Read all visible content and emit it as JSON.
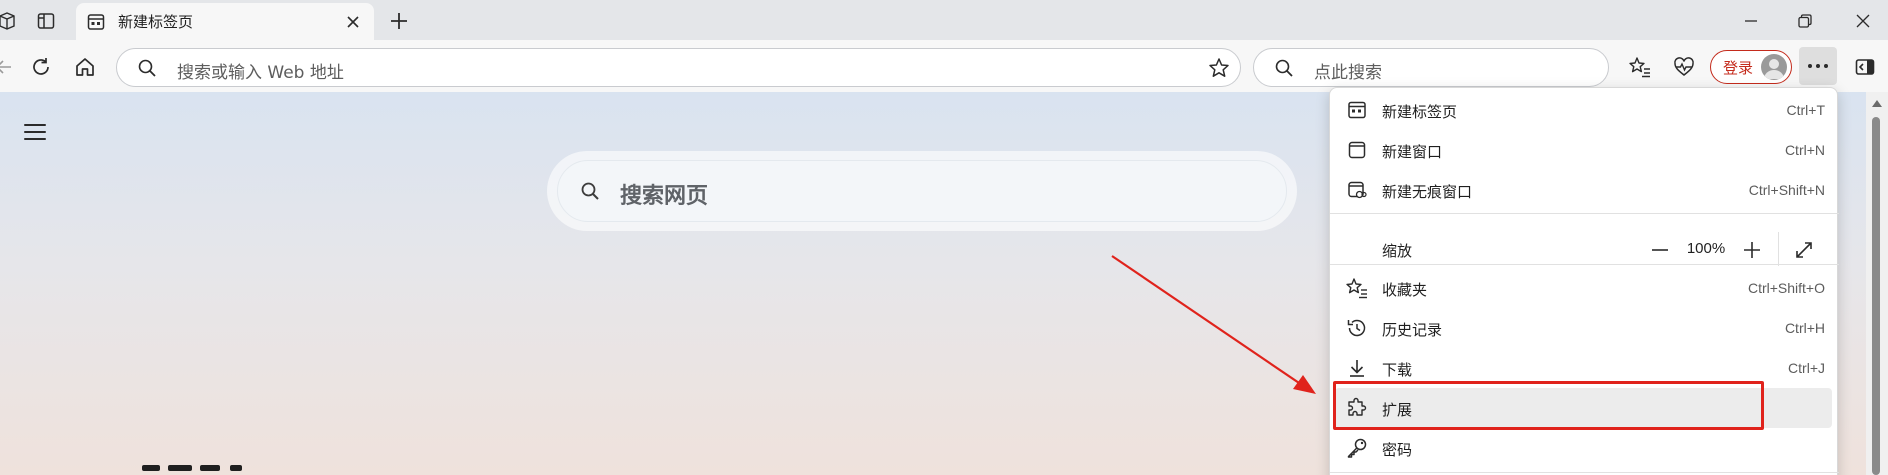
{
  "tab": {
    "title": "新建标签页"
  },
  "toolbar": {
    "address_placeholder": "搜索或输入 Web 地址",
    "search_placeholder": "点此搜索",
    "login_label": "登录"
  },
  "page": {
    "search_placeholder": "搜索网页"
  },
  "menu": {
    "items": [
      {
        "label": "新建标签页",
        "shortcut": "Ctrl+T",
        "icon": "new-tab-icon"
      },
      {
        "label": "新建窗口",
        "shortcut": "Ctrl+N",
        "icon": "new-window-icon"
      },
      {
        "label": "新建无痕窗口",
        "shortcut": "Ctrl+Shift+N",
        "icon": "inprivate-window-icon"
      }
    ],
    "zoom": {
      "label": "缩放",
      "value": "100%"
    },
    "items2": [
      {
        "label": "收藏夹",
        "shortcut": "Ctrl+Shift+O",
        "icon": "favorites-icon"
      },
      {
        "label": "历史记录",
        "shortcut": "Ctrl+H",
        "icon": "history-icon"
      },
      {
        "label": "下载",
        "shortcut": "Ctrl+J",
        "icon": "download-icon"
      },
      {
        "label": "扩展",
        "shortcut": "",
        "icon": "extensions-icon",
        "highlighted": true
      },
      {
        "label": "密码",
        "shortcut": "",
        "icon": "key-icon"
      }
    ]
  },
  "colors": {
    "annotation": "#e0231c",
    "login_accent": "#c42b1c",
    "tabstrip_bg": "#e4e6e9",
    "toolbar_bg": "#f7f7f7"
  }
}
